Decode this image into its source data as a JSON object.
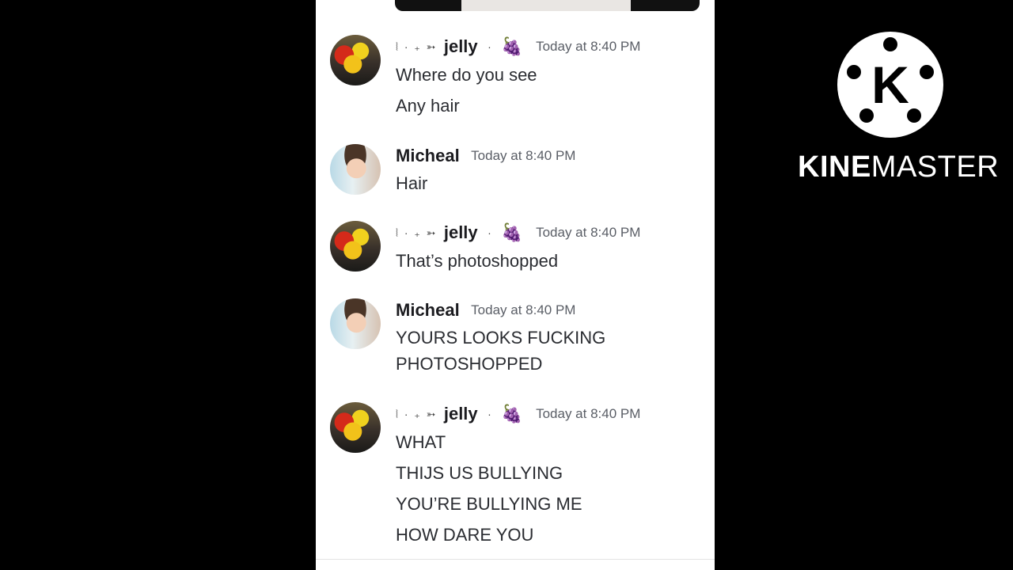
{
  "messages": [
    {
      "author": "jelly",
      "author_prefix": "⦚ · ₊ ➳",
      "author_suffix": "·",
      "emoji": "🍇",
      "timestamp": "Today at 8:40 PM",
      "lines": [
        "Where do you see",
        "Any hair"
      ]
    },
    {
      "author": "Micheal",
      "timestamp": "Today at 8:40 PM",
      "lines": [
        "Hair"
      ]
    },
    {
      "author": "jelly",
      "author_prefix": "⦚ · ₊ ➳",
      "author_suffix": "·",
      "emoji": "🍇",
      "timestamp": "Today at 8:40 PM",
      "lines": [
        "That’s photoshopped"
      ]
    },
    {
      "author": "Micheal",
      "timestamp": "Today at 8:40 PM",
      "lines": [
        "YOURS LOOKS FUCKING",
        "PHOTOSHOPPED"
      ]
    },
    {
      "author": "jelly",
      "author_prefix": "⦚ · ₊ ➳",
      "author_suffix": "·",
      "emoji": "🍇",
      "timestamp": "Today at 8:40 PM",
      "lines": [
        "WHAT",
        "THIJS US BULLYING",
        "YOU’RE BULLYING ME",
        "HOW DARE YOU"
      ]
    }
  ],
  "watermark": {
    "logo_letter": "K",
    "text_bold": "KINE",
    "text_regular": "MASTER"
  },
  "colors": {
    "background": "#000000",
    "chat_background": "#ffffff",
    "username": "#1b1b1f",
    "timestamp": "#5a5e66"
  }
}
